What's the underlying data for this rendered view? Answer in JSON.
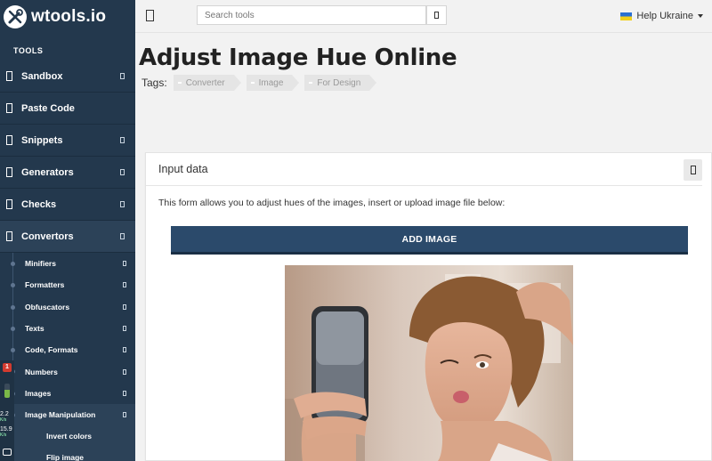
{
  "app": {
    "logo_text": "wtools.io"
  },
  "topbar": {
    "search_placeholder": "Search tools",
    "help_label": "Help Ukraine",
    "colors": {
      "flag_top": "#2a6fd1",
      "flag_bottom": "#f2cf1b"
    }
  },
  "sidebar": {
    "section_label": "TOOLS",
    "items": [
      {
        "label": "Sandbox",
        "has_chevron": true
      },
      {
        "label": "Paste Code",
        "has_chevron": false
      },
      {
        "label": "Snippets",
        "has_chevron": true
      },
      {
        "label": "Generators",
        "has_chevron": true
      },
      {
        "label": "Checks",
        "has_chevron": true
      },
      {
        "label": "Convertors",
        "has_chevron": true,
        "active": true
      }
    ],
    "subitems": [
      {
        "label": "Minifiers"
      },
      {
        "label": "Formatters"
      },
      {
        "label": "Obfuscators"
      },
      {
        "label": "Texts"
      },
      {
        "label": "Code, Formats"
      },
      {
        "label": "Numbers"
      },
      {
        "label": "Images"
      },
      {
        "label": "Image Manipulation",
        "active": true
      }
    ],
    "subsubitems": [
      {
        "label": "Invert colors"
      },
      {
        "label": "Flip image"
      }
    ],
    "colors": {
      "background": "#23384d",
      "active": "#2c4258"
    }
  },
  "overlay": {
    "badge": "1",
    "speed_1": "2.2",
    "speed_1_unit": "K/s",
    "speed_2": "15.9",
    "speed_2_unit": "K/s"
  },
  "page": {
    "title": "Adjust Image Hue Online",
    "tags_label": "Tags:",
    "tags": [
      "Converter",
      "Image",
      "For Design"
    ]
  },
  "card": {
    "header": "Input data",
    "description": "This form allows you to adjust hues of the images, insert or upload image file below:",
    "add_button": "ADD IMAGE",
    "colors": {
      "button": "#2b4a6b"
    }
  }
}
